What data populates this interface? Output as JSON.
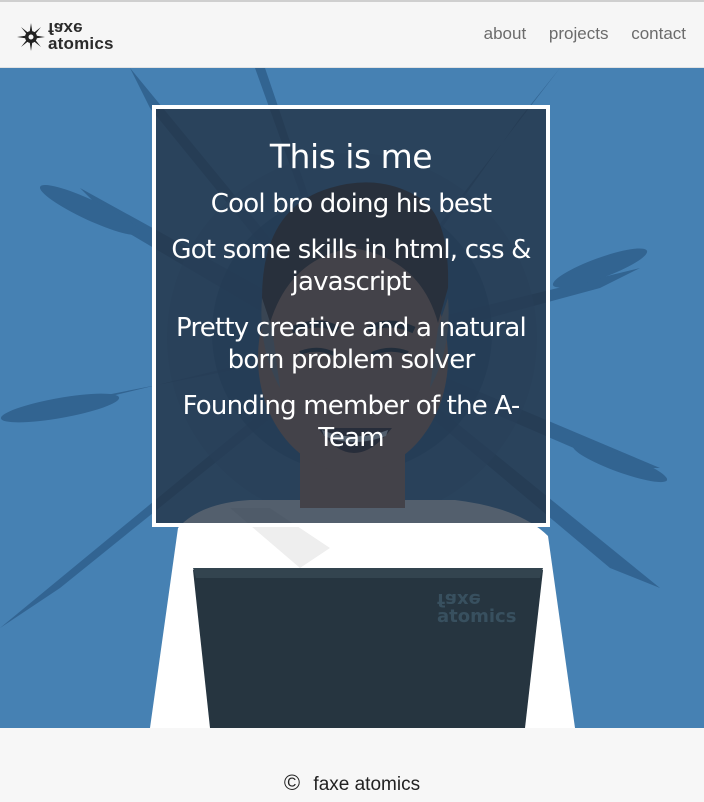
{
  "brand": {
    "line1": "faxe",
    "line2": "atomics",
    "icon": "atom-splat-icon"
  },
  "nav": {
    "items": [
      "about",
      "projects",
      "contact"
    ]
  },
  "hero": {
    "title": "This is me",
    "lines": [
      "Cool bro doing his best",
      "Got some skills in html, css & javascript",
      "Pretty creative and a natural born problem solver",
      "Founding member of the A-Team"
    ],
    "laptop_label_line1": "faxe",
    "laptop_label_line2": "atomics",
    "colors": {
      "background": "#4681b3",
      "card": "#233244",
      "border": "#ffffff"
    }
  },
  "footer": {
    "symbol": "©",
    "text": "faxe atomics"
  }
}
